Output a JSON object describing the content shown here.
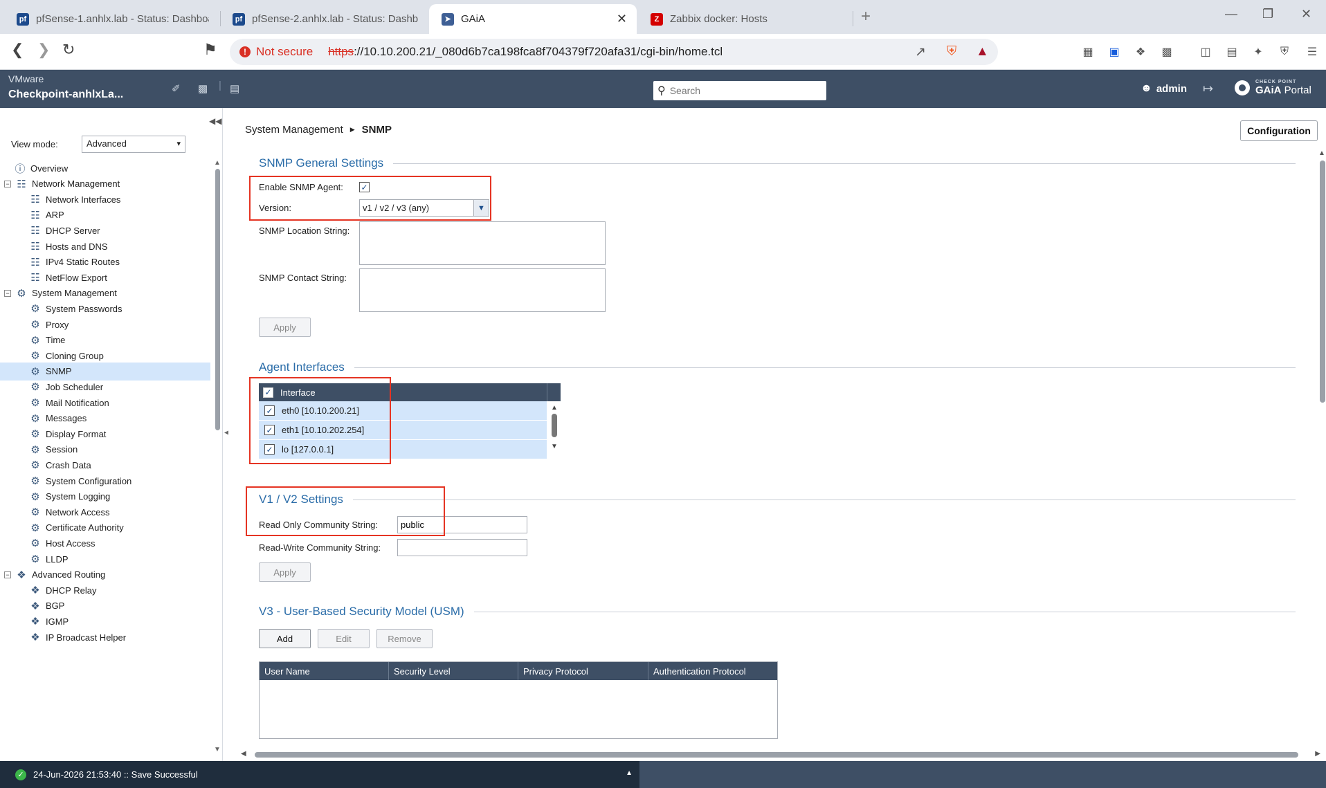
{
  "browser": {
    "tabs": [
      {
        "title": "pfSense-1.anhlx.lab - Status: Dashboard",
        "favicon": "pf",
        "active": false
      },
      {
        "title": "pfSense-2.anhlx.lab - Status: Dashboard",
        "favicon": "pf",
        "active": false
      },
      {
        "title": "GAiA",
        "favicon": "gaia",
        "active": true
      },
      {
        "title": "Zabbix docker: Hosts",
        "favicon": "Z",
        "active": false
      }
    ],
    "security_label": "Not secure",
    "url_protocol": "https",
    "url_rest": "://10.10.200.21/_080d6b7ca198fca8f704379f720afa31/cgi-bin/home.tcl"
  },
  "header": {
    "vendor": "VMware",
    "hostname": "Checkpoint-anhlxLa...",
    "search_placeholder": "Search",
    "user": "admin",
    "brand_small": "CHECK POINT",
    "brand_gaia": "GAiA",
    "brand_portal": " Portal"
  },
  "sidebar": {
    "view_mode_label": "View mode:",
    "view_mode_value": "Advanced",
    "items": [
      {
        "label": "Overview",
        "level": 0,
        "icon": "overview-icon"
      },
      {
        "label": "Network Management",
        "level": 0,
        "icon": "network-icon",
        "expandable": true
      },
      {
        "label": "Network Interfaces",
        "level": 1,
        "icon": "network-icon"
      },
      {
        "label": "ARP",
        "level": 1,
        "icon": "network-icon"
      },
      {
        "label": "DHCP Server",
        "level": 1,
        "icon": "network-icon"
      },
      {
        "label": "Hosts and DNS",
        "level": 1,
        "icon": "network-icon"
      },
      {
        "label": "IPv4 Static Routes",
        "level": 1,
        "icon": "network-icon"
      },
      {
        "label": "NetFlow Export",
        "level": 1,
        "icon": "network-icon"
      },
      {
        "label": "System Management",
        "level": 0,
        "icon": "gear-icon",
        "expandable": true
      },
      {
        "label": "System Passwords",
        "level": 1,
        "icon": "gear-icon"
      },
      {
        "label": "Proxy",
        "level": 1,
        "icon": "gear-icon"
      },
      {
        "label": "Time",
        "level": 1,
        "icon": "gear-icon"
      },
      {
        "label": "Cloning Group",
        "level": 1,
        "icon": "gear-icon"
      },
      {
        "label": "SNMP",
        "level": 1,
        "icon": "gear-icon",
        "selected": true
      },
      {
        "label": "Job Scheduler",
        "level": 1,
        "icon": "gear-icon"
      },
      {
        "label": "Mail Notification",
        "level": 1,
        "icon": "gear-icon"
      },
      {
        "label": "Messages",
        "level": 1,
        "icon": "gear-icon"
      },
      {
        "label": "Display Format",
        "level": 1,
        "icon": "gear-icon"
      },
      {
        "label": "Session",
        "level": 1,
        "icon": "gear-icon"
      },
      {
        "label": "Crash Data",
        "level": 1,
        "icon": "gear-icon"
      },
      {
        "label": "System Configuration",
        "level": 1,
        "icon": "gear-icon"
      },
      {
        "label": "System Logging",
        "level": 1,
        "icon": "gear-icon"
      },
      {
        "label": "Network Access",
        "level": 1,
        "icon": "gear-icon"
      },
      {
        "label": "Certificate Authority",
        "level": 1,
        "icon": "gear-icon"
      },
      {
        "label": "Host Access",
        "level": 1,
        "icon": "gear-icon"
      },
      {
        "label": "LLDP",
        "level": 1,
        "icon": "gear-icon"
      },
      {
        "label": "Advanced Routing",
        "level": 0,
        "icon": "routing-icon",
        "expandable": true
      },
      {
        "label": "DHCP Relay",
        "level": 1,
        "icon": "routing-icon"
      },
      {
        "label": "BGP",
        "level": 1,
        "icon": "routing-icon"
      },
      {
        "label": "IGMP",
        "level": 1,
        "icon": "routing-icon"
      },
      {
        "label": "IP Broadcast Helper",
        "level": 1,
        "icon": "routing-icon"
      }
    ]
  },
  "main": {
    "breadcrumb_parent": "System Management",
    "breadcrumb_current": "SNMP",
    "configuration_button": "Configuration",
    "general": {
      "title": "SNMP General Settings",
      "enable_label": "Enable SNMP Agent:",
      "enable_checked": true,
      "version_label": "Version:",
      "version_value": "v1 / v2 / v3 (any)",
      "location_label": "SNMP Location String:",
      "contact_label": "SNMP Contact String:",
      "apply_label": "Apply"
    },
    "agent": {
      "title": "Agent Interfaces",
      "header": "Interface",
      "interfaces": [
        {
          "name": "eth0 [10.10.200.21]",
          "checked": true
        },
        {
          "name": "eth1 [10.10.202.254]",
          "checked": true
        },
        {
          "name": "lo [127.0.0.1]",
          "checked": true
        }
      ]
    },
    "v1v2": {
      "title": "V1 / V2 Settings",
      "ro_label": "Read Only Community String:",
      "ro_value": "public",
      "rw_label": "Read-Write Community String:",
      "rw_value": "",
      "apply_label": "Apply"
    },
    "v3": {
      "title": "V3 - User-Based Security Model (USM)",
      "add_label": "Add",
      "edit_label": "Edit",
      "remove_label": "Remove",
      "columns": [
        "User Name",
        "Security Level",
        "Privacy Protocol",
        "Authentication Protocol"
      ]
    }
  },
  "status": {
    "message": "24-Jun-2026 21:53:40 :: Save Successful"
  },
  "colors": {
    "header_bg": "#3e4f65",
    "section_title": "#2a6ca8",
    "selection_bg": "#d3e6fb",
    "highlight_red": "#e53423",
    "status_ok": "#3cb64a"
  }
}
